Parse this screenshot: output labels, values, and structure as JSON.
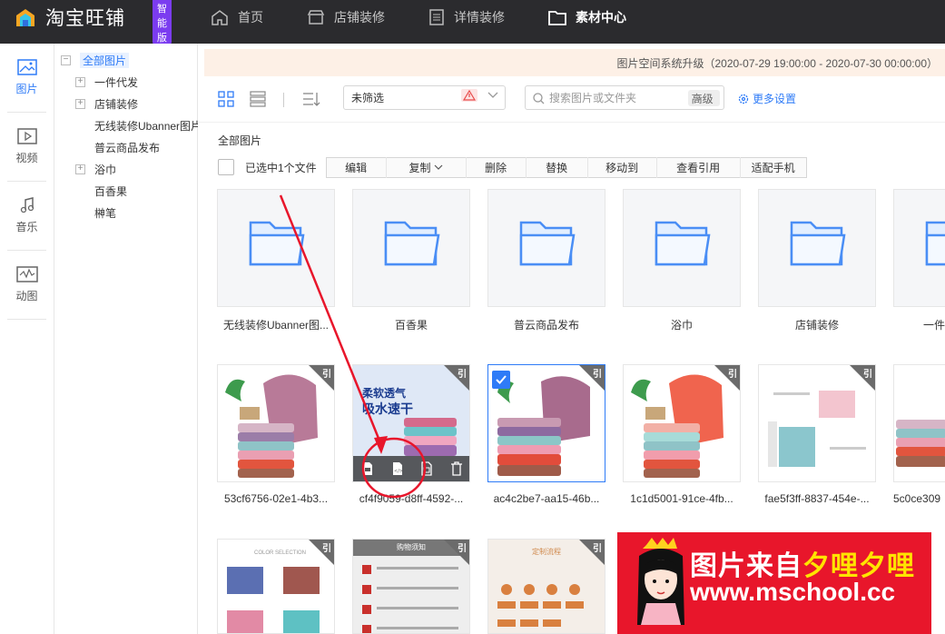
{
  "app": {
    "title": "淘宝旺铺",
    "badge": "智能版"
  },
  "topnav": [
    {
      "label": "首页",
      "icon": "home-icon"
    },
    {
      "label": "店铺装修",
      "icon": "shop-icon"
    },
    {
      "label": "详情装修",
      "icon": "document-icon"
    },
    {
      "label": "素材中心",
      "icon": "folder-icon",
      "active": true
    }
  ],
  "leftnav": [
    {
      "label": "图片",
      "icon": "image-icon",
      "active": true
    },
    {
      "label": "视频",
      "icon": "video-icon"
    },
    {
      "label": "音乐",
      "icon": "music-icon"
    },
    {
      "label": "动图",
      "icon": "animated-image-icon"
    }
  ],
  "tree": {
    "root": "全部图片",
    "items": [
      {
        "label": "一件代发",
        "expandable": true
      },
      {
        "label": "店铺装修",
        "expandable": true
      },
      {
        "label": "无线装修Ubanner图片",
        "expandable": false
      },
      {
        "label": "普云商品发布",
        "expandable": false
      },
      {
        "label": "浴巾",
        "expandable": true
      },
      {
        "label": "百香果",
        "expandable": false
      },
      {
        "label": "榊笔",
        "expandable": false
      }
    ]
  },
  "notice": "图片空间系统升级（2020-07-29 19:00:00 - 2020-07-30 00:00:00）",
  "toolbar": {
    "filter_value": "未筛选",
    "search_placeholder": "搜索图片或文件夹",
    "advanced": "高级",
    "more_settings": "更多设置"
  },
  "breadcrumb": "全部图片",
  "selection": {
    "count_text": "已选中1个文件",
    "actions": [
      "编辑",
      "复制",
      "删除",
      "替换",
      "移动到",
      "查看引用",
      "适配手机"
    ]
  },
  "folders": [
    {
      "name": "无线装修Ubanner图..."
    },
    {
      "name": "百香果"
    },
    {
      "name": "普云商品发布"
    },
    {
      "name": "浴巾"
    },
    {
      "name": "店铺装修"
    },
    {
      "name": "一件"
    }
  ],
  "images": [
    {
      "name": "53cf6756-02e1-4b3...",
      "cite": "引"
    },
    {
      "name": "cf4f9059-d8ff-4592-...",
      "cite": "引",
      "banner_top": "柔软透气",
      "banner_main": "吸水速干"
    },
    {
      "name": "ac4c2be7-aa15-46b...",
      "cite": "引",
      "selected": true
    },
    {
      "name": "1c1d5001-91ce-4fb...",
      "cite": "引"
    },
    {
      "name": "fae5f3ff-8837-454e-...",
      "cite": "引"
    },
    {
      "name": "5c0ce309",
      "cite": "引"
    }
  ],
  "images_row3": [
    {
      "cite": "引",
      "banner": "COLOR SELECTION"
    },
    {
      "cite": "引",
      "banner": "购物须知"
    },
    {
      "cite": "引",
      "banner": "定制流程"
    }
  ],
  "watermark": {
    "line1_a": "图片来自",
    "line1_b": "夕哩夕哩",
    "line2": "www.mschool.cc"
  },
  "colors": {
    "accent": "#2e7bf7",
    "topbar": "#2b2b2e",
    "annotation": "#e8162b"
  }
}
